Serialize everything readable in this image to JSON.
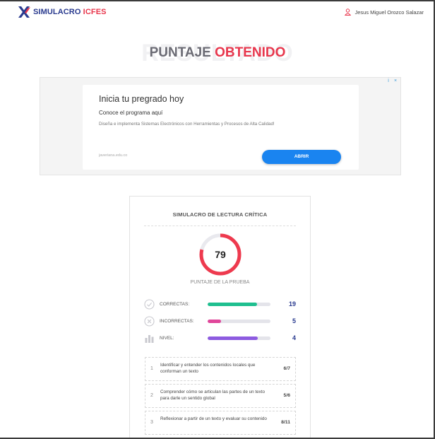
{
  "header": {
    "logo_word1": "SIMULACRO",
    "logo_word2": "ICFES",
    "user_name": "Jesus Miguel Orozco Salazar"
  },
  "title": {
    "ghost": "RESULTADO",
    "word1": "PUNTAJE",
    "word2": "OBTENIDO"
  },
  "ad": {
    "headline": "Inicia tu pregrado hoy",
    "subheadline": "Conoce el programa aquí",
    "description": "Diseña e implementa Sistemas Electrónicos con Herramientas y Procesos de Alta Calidad!",
    "url": "javeriana.edu.co",
    "button_label": "ABRIR",
    "flags": [
      "i",
      "×"
    ]
  },
  "result": {
    "title": "SIMULACRO DE LECTURA CRÍTICA",
    "score": "79",
    "score_fraction": 0.79,
    "score_label": "PUNTAJE DE LA PRUEBA",
    "stats": [
      {
        "label": "CORRECTAS:",
        "value": "19",
        "fraction": 0.79,
        "color": "#1fbf8f",
        "icon": "check-circle-icon"
      },
      {
        "label": "INCORRECTAS:",
        "value": "5",
        "fraction": 0.21,
        "color": "#e0469a",
        "icon": "x-circle-icon"
      },
      {
        "label": "NIVEL:",
        "value": "4",
        "fraction": 0.8,
        "color": "#8d5be0",
        "icon": "bar-chart-icon"
      }
    ],
    "competencies": [
      {
        "num": "1",
        "text": "Identificar y entender los contenidos locales que conforman un texto",
        "score": "6/7"
      },
      {
        "num": "2",
        "text": "Comprender cómo se articulan las partes de un texto para darle un sentido global",
        "score": "5/6"
      },
      {
        "num": "3",
        "text": "Reflexionar a partir de un texto y evaluar su contenido",
        "score": "8/11"
      }
    ]
  },
  "colors": {
    "brand_blue": "#2a3b8f",
    "brand_red": "#e8374d",
    "ad_button": "#1a84f0"
  }
}
